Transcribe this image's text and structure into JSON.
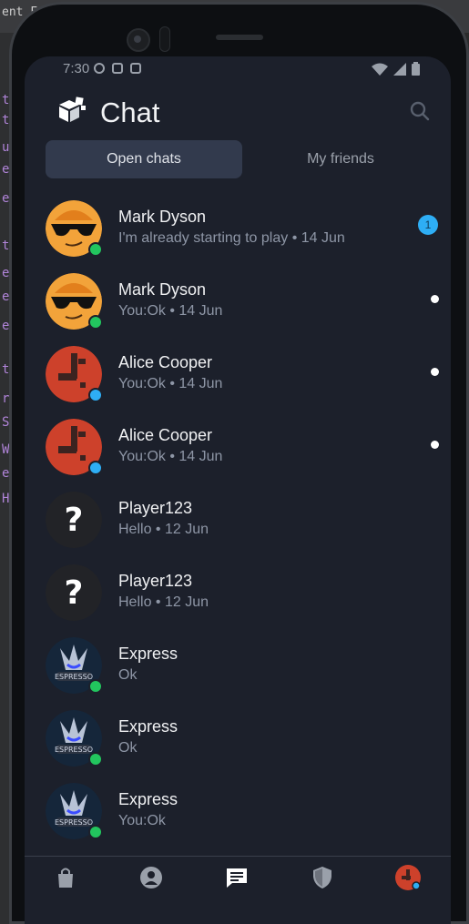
{
  "ide": {
    "title_fragment": "ent F",
    "gutter_chars": [
      "u",
      "e",
      "e",
      "t",
      "e",
      "e",
      "e",
      "t",
      "r",
      "S",
      "W",
      "e",
      "H"
    ],
    "gutter_top_chars": [
      "t",
      "t"
    ]
  },
  "status_bar": {
    "time": "7:30"
  },
  "header": {
    "title": "Chat"
  },
  "tabs": [
    {
      "label": "Open chats",
      "active": true
    },
    {
      "label": "My friends",
      "active": false
    }
  ],
  "chats": [
    {
      "name": "Mark Dyson",
      "preview": "I'm already starting to play • 14 Jun",
      "avatar": "sunglasses-face",
      "presence": "#22c55e",
      "unread": "1",
      "dot": false
    },
    {
      "name": "Mark Dyson",
      "preview": "You:Ok • 14 Jun",
      "avatar": "sunglasses-face",
      "presence": "#22c55e",
      "unread": "",
      "dot": true
    },
    {
      "name": "Alice Cooper",
      "preview": "You:Ok • 14 Jun",
      "avatar": "rust-logo",
      "presence": "#2eaef5",
      "unread": "",
      "dot": true
    },
    {
      "name": "Alice Cooper",
      "preview": "You:Ok • 14 Jun",
      "avatar": "rust-logo",
      "presence": "#2eaef5",
      "unread": "",
      "dot": true
    },
    {
      "name": "Player123",
      "preview": "Hello • 12 Jun",
      "avatar": "question-mark",
      "presence": "",
      "unread": "",
      "dot": false
    },
    {
      "name": "Player123",
      "preview": "Hello • 12 Jun",
      "avatar": "question-mark",
      "presence": "",
      "unread": "",
      "dot": false
    },
    {
      "name": "Express",
      "preview": "Ok",
      "avatar": "espresso-logo",
      "presence": "#22c55e",
      "unread": "",
      "dot": false
    },
    {
      "name": "Express",
      "preview": "Ok",
      "avatar": "espresso-logo",
      "presence": "#22c55e",
      "unread": "",
      "dot": false
    },
    {
      "name": "Express",
      "preview": "You:Ok",
      "avatar": "espresso-logo",
      "presence": "#22c55e",
      "unread": "",
      "dot": false
    }
  ],
  "bottom_nav": [
    {
      "icon": "shopping-bag-icon",
      "active": false
    },
    {
      "icon": "profile-icon",
      "active": false
    },
    {
      "icon": "chat-icon",
      "active": true
    },
    {
      "icon": "shield-icon",
      "active": false
    },
    {
      "icon": "user-avatar-rust-icon",
      "active": false
    }
  ],
  "colors": {
    "background": "#1c202b",
    "active_tab": "#323a4d",
    "unread_badge": "#2eaef5",
    "online_green": "#22c55e",
    "online_blue": "#2eaef5"
  }
}
